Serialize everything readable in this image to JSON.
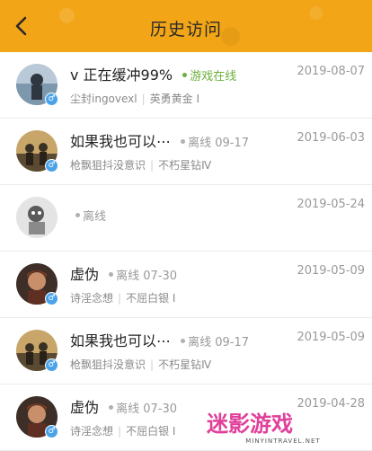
{
  "header": {
    "title": "历史访问",
    "back_icon": "chevron-left-icon"
  },
  "visitors": [
    {
      "name": "ⅴ 正在缓冲99%",
      "status": "游戏在线",
      "online": true,
      "nickname": "尘封ingovexl",
      "rank": "英勇黄金 Ⅰ",
      "date": "2019-08-07",
      "gender": "♂"
    },
    {
      "name": "如果我也可以⋯",
      "status": "离线 09-17",
      "online": false,
      "nickname": "枪飘狙抖没意识",
      "rank": "不朽星钻Ⅳ",
      "date": "2019-06-03",
      "gender": "♂"
    },
    {
      "name": "",
      "status": "离线",
      "online": false,
      "nickname": "",
      "rank": "",
      "date": "2019-05-24",
      "gender": ""
    },
    {
      "name": "虚伪",
      "status": "离线 07-30",
      "online": false,
      "nickname": "诗淫念想",
      "rank": "不屈白银 Ⅰ",
      "date": "2019-05-09",
      "gender": "♂"
    },
    {
      "name": "如果我也可以⋯",
      "status": "离线 09-17",
      "online": false,
      "nickname": "枪飘狙抖没意识",
      "rank": "不朽星钻Ⅳ",
      "date": "2019-05-09",
      "gender": "♂"
    },
    {
      "name": "虚伪",
      "status": "离线 07-30",
      "online": false,
      "nickname": "诗淫念想",
      "rank": "不屈白银 Ⅰ",
      "date": "2019-04-28",
      "gender": "♂"
    }
  ],
  "watermark": {
    "text": "迷影游戏",
    "url": "MINYINTRAVEL.NET"
  },
  "colors": {
    "header": "#f2a516",
    "online": "#6bb03b",
    "gender": "#4aa3e8"
  }
}
